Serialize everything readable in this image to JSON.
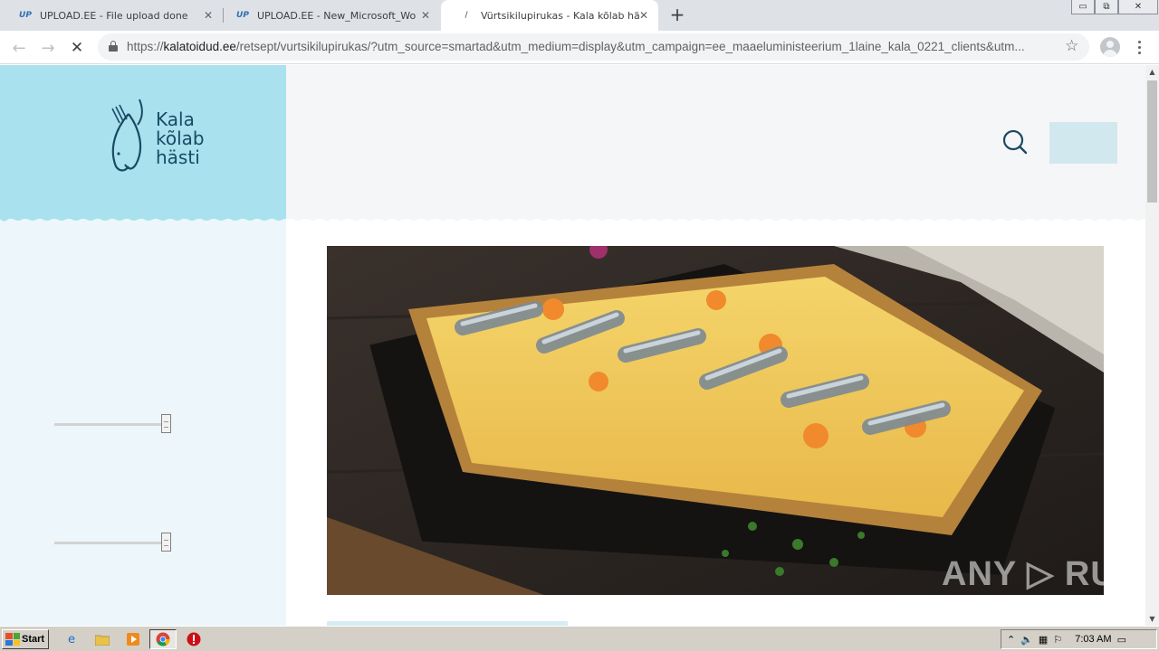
{
  "browser": {
    "tabs": [
      {
        "favicon": "UP",
        "title": "UPLOAD.EE - File upload done",
        "active": false
      },
      {
        "favicon": "UP",
        "title": "UPLOAD.EE - New_Microsoft_Word_",
        "active": false
      },
      {
        "favicon": "/",
        "title": "Vürtsikilupirukas - Kala kõlab hästi",
        "active": true
      }
    ],
    "new_tab_icon": "plus-icon",
    "window_controls": {
      "minimize": "▭",
      "restore": "⧉",
      "close": "✕"
    },
    "nav": {
      "back": "←",
      "forward": "→",
      "stop": "✕"
    },
    "url_protocol": "https://",
    "url_host": "kalatoidud.ee",
    "url_path": "/retsept/vurtsikilupirukas/?utm_source=smartad&utm_medium=display&utm_campaign=ee_maaeluministeerium_1laine_kala_0221_clients&utm...",
    "bookmark_icon": "☆"
  },
  "site": {
    "logo_lines": [
      "Kala",
      "kõlab",
      "hästi"
    ],
    "brand_colors": {
      "sidebar_header": "#a9e1ef",
      "sidebar": "#edf6fa",
      "logo_ink": "#1a4a62",
      "header_button": "#d2e8ef"
    },
    "hero_image_alt": "Vürtsikilupirukas",
    "sliders": [
      {
        "value": 1.0
      },
      {
        "value": 1.0
      }
    ]
  },
  "watermark": "ANY ▷ RUN",
  "taskbar": {
    "start_label": "Start",
    "apps": [
      "internet-explorer-icon",
      "folder-icon",
      "media-player-icon",
      "chrome-icon",
      "opera-icon"
    ],
    "clock": "7:03 AM"
  }
}
